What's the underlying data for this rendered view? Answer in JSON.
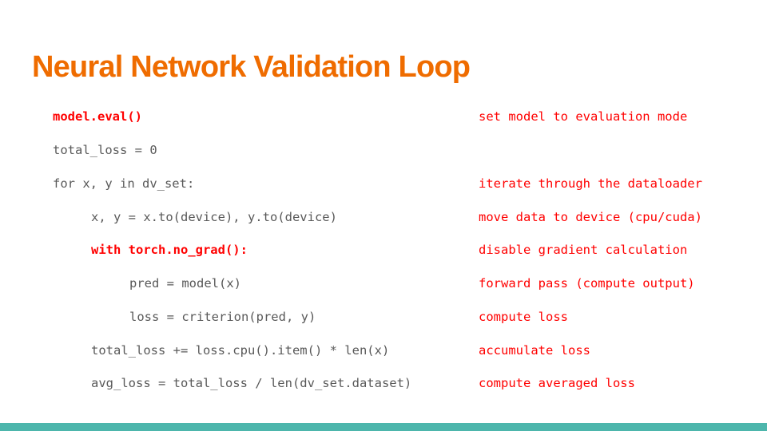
{
  "title": "Neural Network Validation Loop",
  "code_lines": [
    {
      "text": "model.eval()",
      "highlight": true
    },
    {
      "text": "total_loss = 0",
      "highlight": false
    },
    {
      "text": "for x, y in dv_set:",
      "highlight": false
    },
    {
      "text": "x, y = x.to(device), y.to(device)",
      "highlight": false
    },
    {
      "text": "with torch.no_grad():",
      "highlight": true
    },
    {
      "text": "pred = model(x)",
      "highlight": false
    },
    {
      "text": "loss = criterion(pred, y)",
      "highlight": false
    },
    {
      "text": "total_loss += loss.cpu().item() * len(x)",
      "highlight": false
    },
    {
      "text": "avg_loss = total_loss / len(dv_set.dataset)",
      "highlight": false
    }
  ],
  "comments": [
    "set model to evaluation mode",
    "iterate through the dataloader",
    "move data to device (cpu/cuda)",
    "disable gradient calculation",
    "forward pass (compute output)",
    "compute loss",
    "accumulate loss",
    "compute averaged loss"
  ],
  "colors": {
    "title": "#ef6c00",
    "code": "#595959",
    "highlight": "#ff0000",
    "footer_bar": "#4db6ac"
  }
}
